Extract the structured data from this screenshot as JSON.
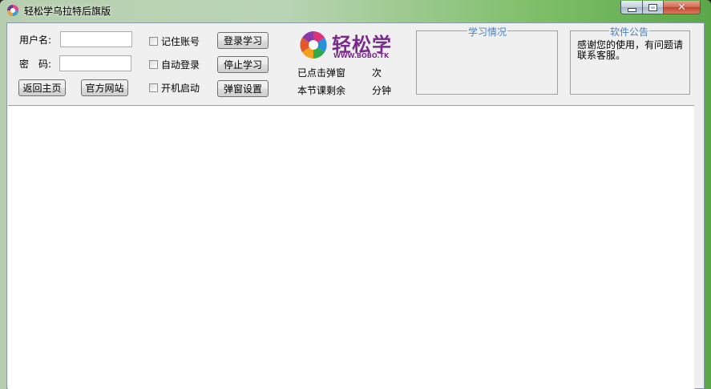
{
  "window": {
    "title": "轻松学乌拉特后旗版",
    "close_glyph": "✕"
  },
  "login": {
    "username_label": "用户名:",
    "password_label": "密　码:",
    "username_value": "",
    "password_value": ""
  },
  "buttons": {
    "home": "返回主页",
    "official_site": "官方网站",
    "login_study": "登录学习",
    "stop_study": "停止学习",
    "popup_settings": "弹窗设置"
  },
  "options": {
    "remember_account": "记住账号",
    "auto_login": "自动登录",
    "startup_launch": "开机启动"
  },
  "logo": {
    "text": "轻松学",
    "sub": "WWW.BOBO.TK"
  },
  "stats": {
    "clicked_popup_label": "已点击弹窗",
    "clicked_popup_unit": "次",
    "remaining_label": "本节课剩余",
    "remaining_unit": "分钟"
  },
  "study_status": {
    "title": "学习情况"
  },
  "notice": {
    "title": "软件公告",
    "text": "感谢您的使用，有问题请联系客服。"
  },
  "colors": {
    "group_title": "#4b7fb8",
    "logo": "#7a2a8a"
  }
}
